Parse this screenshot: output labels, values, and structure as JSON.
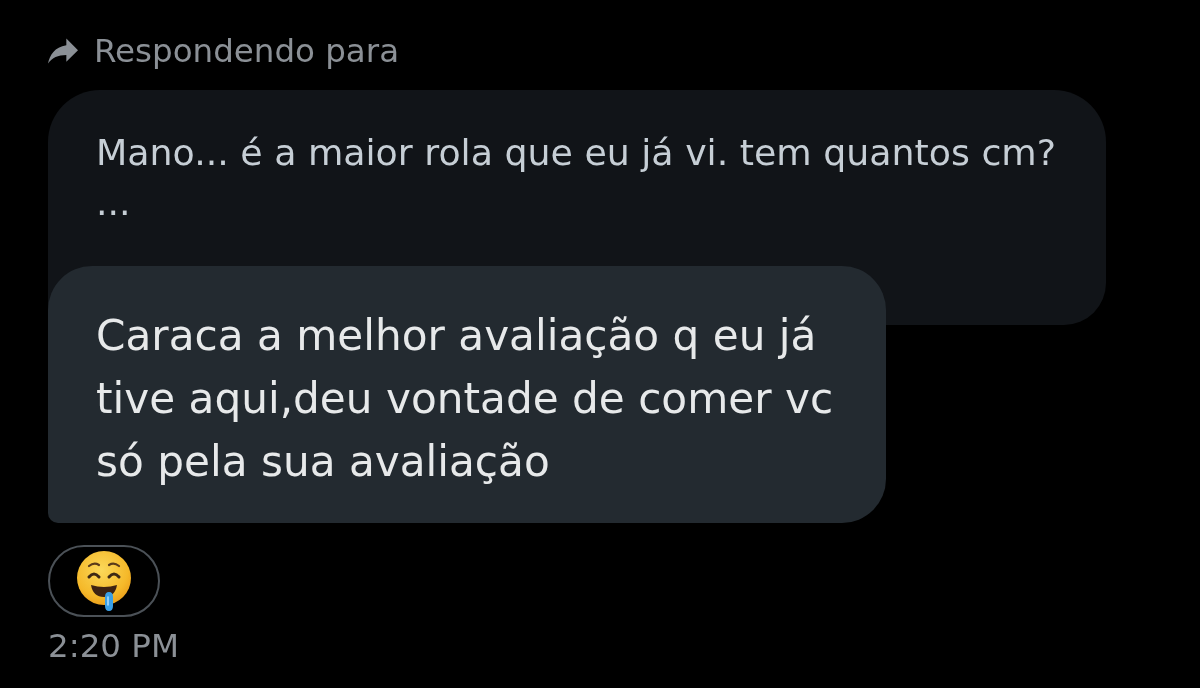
{
  "reply_header": {
    "label": "Respondendo para"
  },
  "quoted_message": {
    "lines": [
      "Mano... é a maior rola que eu já vi. tem quantos cm?",
      "..."
    ]
  },
  "message": {
    "lines": [
      "Caraca a melhor avaliação q eu já",
      "tive aqui,deu vontade de comer vc",
      "só pela sua avaliação"
    ]
  },
  "timestamp": "2:20 PM"
}
